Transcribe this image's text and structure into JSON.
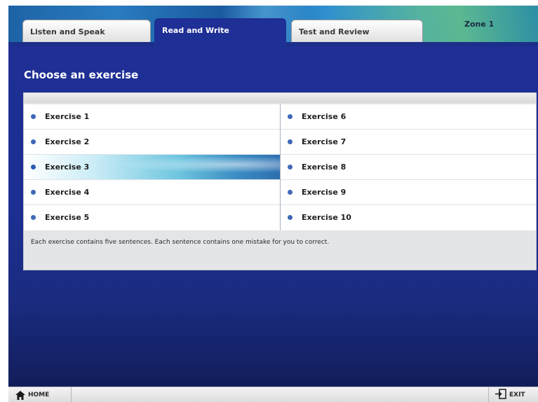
{
  "tabs": [
    {
      "label": "Listen and Speak",
      "active": false
    },
    {
      "label": "Read and Write",
      "active": true
    },
    {
      "label": "Test and Review",
      "active": false
    }
  ],
  "zone": "Zone 1",
  "page_title": "Choose an exercise",
  "exercises": {
    "left": [
      "Exercise 1",
      "Exercise 2",
      "Exercise 3",
      "Exercise 4",
      "Exercise 5"
    ],
    "right": [
      "Exercise 6",
      "Exercise 7",
      "Exercise 8",
      "Exercise 9",
      "Exercise 10"
    ],
    "selected": "Exercise 3"
  },
  "description": "Each exercise contains five sentences. Each sentence contains one mistake for you to correct.",
  "footer": {
    "home_label": "HOME",
    "exit_label": "EXIT",
    "home_icon": "house-icon",
    "exit_icon": "exit-icon"
  },
  "colors": {
    "primary_blue": "#1e2f95",
    "bullet": "#3f68b8"
  }
}
